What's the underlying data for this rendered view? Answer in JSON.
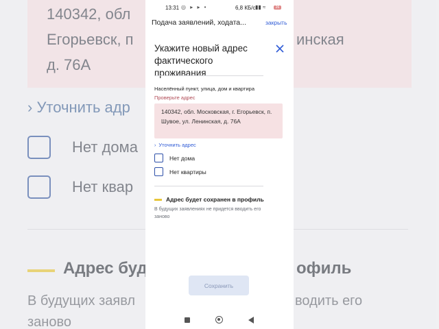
{
  "background": {
    "address_lines": [
      "140342, обл",
      "Егорьевск, п",
      "д. 76А"
    ],
    "address_lines_right": [
      "инская"
    ],
    "refine": "Уточнить адр",
    "no_house": "Нет дома",
    "no_flat": "Нет квар",
    "saved_title_left": "Адрес буд",
    "saved_title_right": "офиль",
    "saved_sub_left_1": "В будущих заявл",
    "saved_sub_right_1": "водить его",
    "saved_sub_left_2": "заново"
  },
  "status_bar": {
    "time": "13:31",
    "speed": "6,8 КБ/с",
    "battery": "26"
  },
  "header": {
    "title": "Подача заявлений, ходата...",
    "close_label": "закрыть"
  },
  "modal": {
    "title": "Укажите новый адрес фактического проживания",
    "field_label": "Населённый пункт, улица, дом и квартира",
    "error_text": "Проверьте адрес",
    "address_value": "140342, обл. Московская, г. Егорьевск, п. Шувое, ул. Ленинская, д. 76А",
    "refine_link": "Уточнить адрес",
    "checkbox_no_house": "Нет дома",
    "checkbox_no_flat": "Нет квартиры",
    "saved_title": "Адрес будет сохранен в профиль",
    "saved_subtitle": "В будущих заявлениях не придется вводить его заново",
    "save_button": "Сохранить"
  },
  "colors": {
    "accent": "#2f5bd6",
    "error": "#b04a55",
    "address_bg": "#f6e1e3",
    "highlight": "#e7c63a"
  }
}
